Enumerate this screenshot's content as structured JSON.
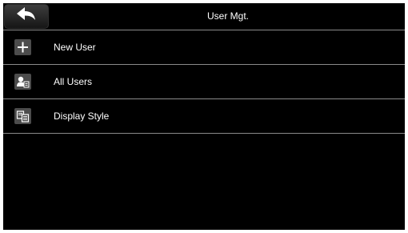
{
  "header": {
    "title": "User Mgt.",
    "back_icon": "back-arrow-icon"
  },
  "menu": {
    "items": [
      {
        "label": "New User",
        "icon": "plus-icon"
      },
      {
        "label": "All Users",
        "icon": "user-list-icon"
      },
      {
        "label": "Display Style",
        "icon": "display-style-icon"
      }
    ]
  },
  "colors": {
    "background": "#000000",
    "text": "#ffffff",
    "divider": "#8a8a8a",
    "icon_tile": "#4c4c4c"
  }
}
